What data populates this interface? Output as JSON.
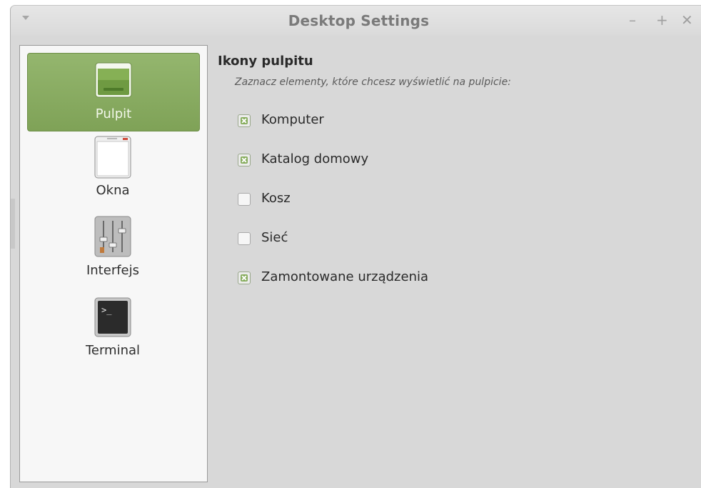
{
  "window": {
    "title": "Desktop Settings",
    "menu_icon": "chevron-down-icon",
    "minimize_label": "–",
    "maximize_label": "+",
    "close_label": "✕"
  },
  "sidebar": {
    "items": [
      {
        "label": "Pulpit",
        "icon": "desktop-icon",
        "selected": true
      },
      {
        "label": "Okna",
        "icon": "window-icon",
        "selected": false
      },
      {
        "label": "Interfejs",
        "icon": "sliders-icon",
        "selected": false
      },
      {
        "label": "Terminal",
        "icon": "terminal-icon",
        "selected": false
      }
    ]
  },
  "main": {
    "heading": "Ikony pulpitu",
    "subtitle": "Zaznacz elementy, które chcesz wyświetlić na pulpicie:",
    "options": [
      {
        "label": "Komputer",
        "checked": true
      },
      {
        "label": "Katalog domowy",
        "checked": true
      },
      {
        "label": "Kosz",
        "checked": false
      },
      {
        "label": "Sieć",
        "checked": false
      },
      {
        "label": "Zamontowane urządzenia",
        "checked": true
      }
    ]
  },
  "colors": {
    "accent": "#86ac5c",
    "selection": "#8aad63",
    "window_bg": "#d8d8d8",
    "sidebar_bg": "#f7f7f7"
  }
}
